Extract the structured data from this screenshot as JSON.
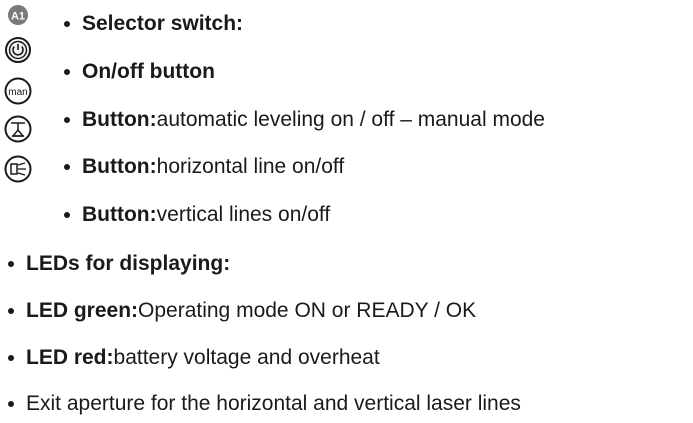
{
  "icons": {
    "a1": {
      "name": "a1-icon",
      "label": "A1"
    },
    "power": {
      "name": "power-icon"
    },
    "man": {
      "name": "man-icon",
      "label": "man"
    },
    "leveling": {
      "name": "leveling-icon"
    },
    "laser": {
      "name": "laser-line-icon"
    }
  },
  "items": [
    {
      "bold": "Selector switch:",
      "text": ""
    },
    {
      "bold": "On/off button",
      "text": ""
    },
    {
      "bold": "Button:",
      "text": " automatic leveling on / off – manual mode"
    },
    {
      "bold": "Button:",
      "text": " horizontal line on/off"
    },
    {
      "bold": "Button:",
      "text": " vertical lines on/off"
    },
    {
      "bold": "LEDs for displaying:",
      "text": ""
    },
    {
      "bold": "LED green:",
      "text": " Operating mode ON or READY / OK"
    },
    {
      "bold": "LED red:",
      "text": " battery voltage and overheat"
    },
    {
      "bold": "",
      "text": "Exit aperture for the horizontal and vertical laser lines"
    }
  ]
}
